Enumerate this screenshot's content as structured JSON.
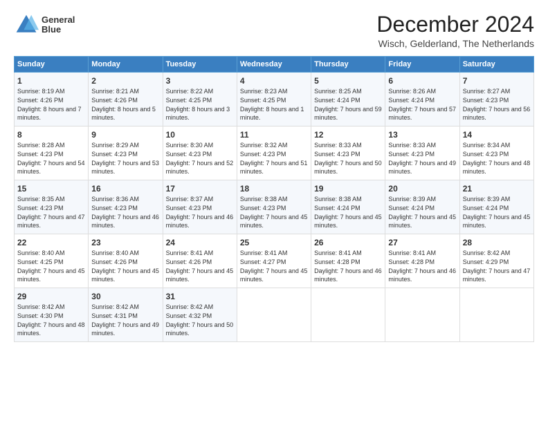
{
  "logo": {
    "line1": "General",
    "line2": "Blue"
  },
  "title": "December 2024",
  "subtitle": "Wisch, Gelderland, The Netherlands",
  "days_of_week": [
    "Sunday",
    "Monday",
    "Tuesday",
    "Wednesday",
    "Thursday",
    "Friday",
    "Saturday"
  ],
  "weeks": [
    [
      {
        "day": "1",
        "sunrise": "8:19 AM",
        "sunset": "4:26 PM",
        "daylight": "8 hours and 7 minutes."
      },
      {
        "day": "2",
        "sunrise": "8:21 AM",
        "sunset": "4:26 PM",
        "daylight": "8 hours and 5 minutes."
      },
      {
        "day": "3",
        "sunrise": "8:22 AM",
        "sunset": "4:25 PM",
        "daylight": "8 hours and 3 minutes."
      },
      {
        "day": "4",
        "sunrise": "8:23 AM",
        "sunset": "4:25 PM",
        "daylight": "8 hours and 1 minute."
      },
      {
        "day": "5",
        "sunrise": "8:25 AM",
        "sunset": "4:24 PM",
        "daylight": "7 hours and 59 minutes."
      },
      {
        "day": "6",
        "sunrise": "8:26 AM",
        "sunset": "4:24 PM",
        "daylight": "7 hours and 57 minutes."
      },
      {
        "day": "7",
        "sunrise": "8:27 AM",
        "sunset": "4:23 PM",
        "daylight": "7 hours and 56 minutes."
      }
    ],
    [
      {
        "day": "8",
        "sunrise": "8:28 AM",
        "sunset": "4:23 PM",
        "daylight": "7 hours and 54 minutes."
      },
      {
        "day": "9",
        "sunrise": "8:29 AM",
        "sunset": "4:23 PM",
        "daylight": "7 hours and 53 minutes."
      },
      {
        "day": "10",
        "sunrise": "8:30 AM",
        "sunset": "4:23 PM",
        "daylight": "7 hours and 52 minutes."
      },
      {
        "day": "11",
        "sunrise": "8:32 AM",
        "sunset": "4:23 PM",
        "daylight": "7 hours and 51 minutes."
      },
      {
        "day": "12",
        "sunrise": "8:33 AM",
        "sunset": "4:23 PM",
        "daylight": "7 hours and 50 minutes."
      },
      {
        "day": "13",
        "sunrise": "8:33 AM",
        "sunset": "4:23 PM",
        "daylight": "7 hours and 49 minutes."
      },
      {
        "day": "14",
        "sunrise": "8:34 AM",
        "sunset": "4:23 PM",
        "daylight": "7 hours and 48 minutes."
      }
    ],
    [
      {
        "day": "15",
        "sunrise": "8:35 AM",
        "sunset": "4:23 PM",
        "daylight": "7 hours and 47 minutes."
      },
      {
        "day": "16",
        "sunrise": "8:36 AM",
        "sunset": "4:23 PM",
        "daylight": "7 hours and 46 minutes."
      },
      {
        "day": "17",
        "sunrise": "8:37 AM",
        "sunset": "4:23 PM",
        "daylight": "7 hours and 46 minutes."
      },
      {
        "day": "18",
        "sunrise": "8:38 AM",
        "sunset": "4:23 PM",
        "daylight": "7 hours and 45 minutes."
      },
      {
        "day": "19",
        "sunrise": "8:38 AM",
        "sunset": "4:24 PM",
        "daylight": "7 hours and 45 minutes."
      },
      {
        "day": "20",
        "sunrise": "8:39 AM",
        "sunset": "4:24 PM",
        "daylight": "7 hours and 45 minutes."
      },
      {
        "day": "21",
        "sunrise": "8:39 AM",
        "sunset": "4:24 PM",
        "daylight": "7 hours and 45 minutes."
      }
    ],
    [
      {
        "day": "22",
        "sunrise": "8:40 AM",
        "sunset": "4:25 PM",
        "daylight": "7 hours and 45 minutes."
      },
      {
        "day": "23",
        "sunrise": "8:40 AM",
        "sunset": "4:26 PM",
        "daylight": "7 hours and 45 minutes."
      },
      {
        "day": "24",
        "sunrise": "8:41 AM",
        "sunset": "4:26 PM",
        "daylight": "7 hours and 45 minutes."
      },
      {
        "day": "25",
        "sunrise": "8:41 AM",
        "sunset": "4:27 PM",
        "daylight": "7 hours and 45 minutes."
      },
      {
        "day": "26",
        "sunrise": "8:41 AM",
        "sunset": "4:28 PM",
        "daylight": "7 hours and 46 minutes."
      },
      {
        "day": "27",
        "sunrise": "8:41 AM",
        "sunset": "4:28 PM",
        "daylight": "7 hours and 46 minutes."
      },
      {
        "day": "28",
        "sunrise": "8:42 AM",
        "sunset": "4:29 PM",
        "daylight": "7 hours and 47 minutes."
      }
    ],
    [
      {
        "day": "29",
        "sunrise": "8:42 AM",
        "sunset": "4:30 PM",
        "daylight": "7 hours and 48 minutes."
      },
      {
        "day": "30",
        "sunrise": "8:42 AM",
        "sunset": "4:31 PM",
        "daylight": "7 hours and 49 minutes."
      },
      {
        "day": "31",
        "sunrise": "8:42 AM",
        "sunset": "4:32 PM",
        "daylight": "7 hours and 50 minutes."
      },
      null,
      null,
      null,
      null
    ]
  ],
  "labels": {
    "sunrise": "Sunrise:",
    "sunset": "Sunset:",
    "daylight": "Daylight:"
  }
}
